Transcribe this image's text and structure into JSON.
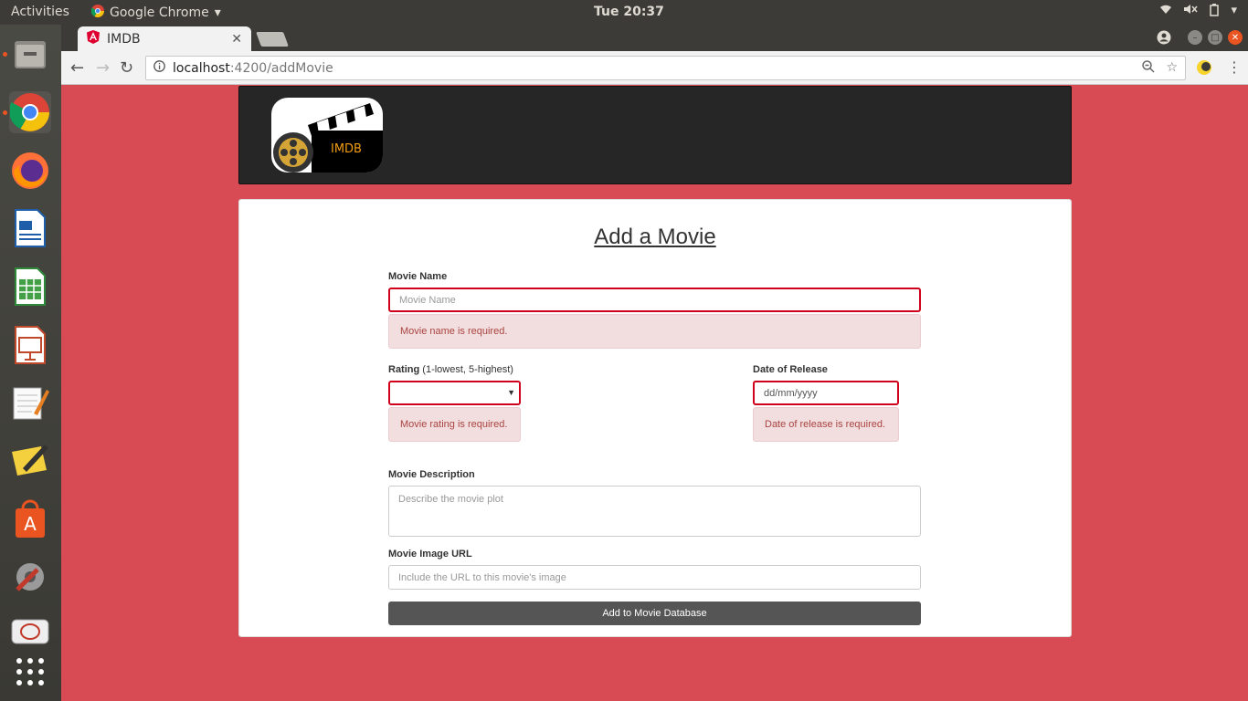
{
  "system": {
    "activities_label": "Activities",
    "app_name": "Google Chrome",
    "clock": "Tue 20:37"
  },
  "browser": {
    "tab_title": "IMDB",
    "url_host": "localhost",
    "url_path": ":4200/addMovie"
  },
  "logo": {
    "text": "IMDB"
  },
  "form": {
    "title": "Add a Movie",
    "movie_name": {
      "label": "Movie Name",
      "placeholder": "Movie Name",
      "error": "Movie name is required."
    },
    "rating": {
      "label": "Rating",
      "hint": "(1-lowest, 5-highest)",
      "value": "",
      "error": "Movie rating is required."
    },
    "release": {
      "label": "Date of Release",
      "placeholder": "dd/mm/yyyy",
      "error": "Date of release is required."
    },
    "description": {
      "label": "Movie Description",
      "placeholder": "Describe the movie plot"
    },
    "image_url": {
      "label": "Movie Image URL",
      "placeholder": "Include the URL to this movie's image"
    },
    "submit_label": "Add to Movie Database"
  },
  "colors": {
    "page_background": "#d94b54",
    "error_border": "#d0021b",
    "error_bg": "#f2dede",
    "error_text": "#a94442",
    "button_bg": "#555555"
  }
}
